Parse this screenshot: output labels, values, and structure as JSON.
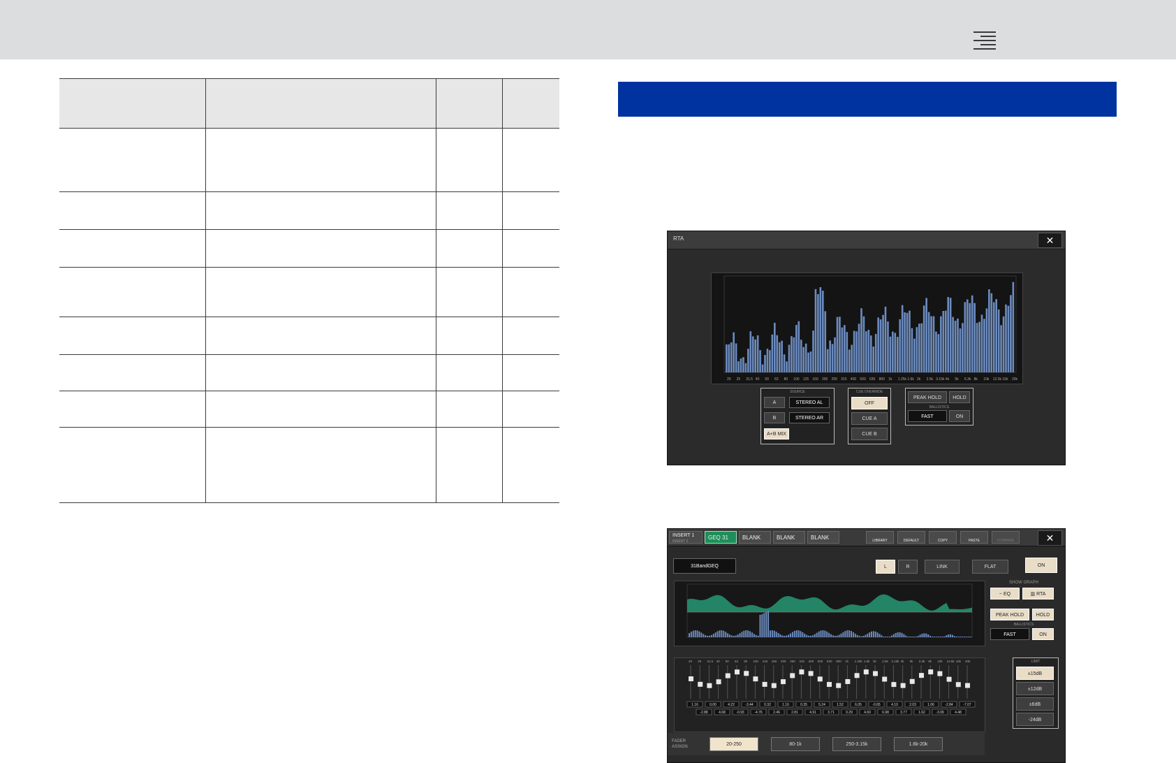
{
  "rta_window": {
    "title": "RTA",
    "close": "✕",
    "source_label": "SOURCE",
    "btn_a": "A",
    "btn_b": "B",
    "btn_ab": "A+B MIX",
    "stereo_al": "STEREO AL",
    "stereo_ar": "STEREO AR",
    "cue_override_label": "CUE OVERRIDE",
    "cue_off": "OFF",
    "cue_a": "CUE A",
    "cue_b": "CUE B",
    "peak_hold": "PEAK HOLD",
    "hold": "HOLD",
    "ballistics_label": "BALLISTICS",
    "ballistics_value": "FAST",
    "ballistics_on": "ON",
    "freq_labels": [
      "20",
      "25",
      "31.5",
      "40",
      "50",
      "63",
      "80",
      "100",
      "125",
      "160",
      "200",
      "250",
      "315",
      "400",
      "500",
      "630",
      "800",
      "1k",
      "1.25k",
      "1.6k",
      "2k",
      "2.5k",
      "3.15k",
      "4k",
      "5k",
      "6.3k",
      "8k",
      "10k",
      "12.5k",
      "16k",
      "20k"
    ]
  },
  "geq_window": {
    "insert_label": "INSERT 1",
    "insert_sub": "INSERT 2",
    "tab_active": "GEQ 31",
    "tabs": [
      "BLANK",
      "BLANK",
      "BLANK"
    ],
    "toolbar": [
      "LIBRARY",
      "DEFAULT",
      "COPY",
      "PASTE",
      "COMPARE"
    ],
    "close": "✕",
    "preset_name": "31BandGEQ",
    "btn_l": "L",
    "btn_r": "R",
    "btn_link": "LINK",
    "btn_flat": "FLAT",
    "btn_on": "ON",
    "show_graph": "SHOW GRAPH",
    "eq": "EQ",
    "rta": "RTA",
    "peak_hold": "PEAK HOLD",
    "hold": "HOLD",
    "ballistics_label": "BALLISTICS",
    "ballistics_value": "FAST",
    "ballistics_on": "ON",
    "limit_label": "LIMIT",
    "limits": [
      "±15dB",
      "±12dB",
      "±6dB",
      "-24dB"
    ],
    "fader_assign_label": "FADER ASSIGN",
    "fader_assign": [
      "20-250",
      "80-1k",
      "250-3.15k",
      "1.6k-20k"
    ],
    "band_values_top": [
      "1.16",
      "0.00",
      "4.22",
      "-3.44",
      "0.32",
      "1.16",
      "0.35",
      "5.24",
      "1.52",
      "6.05",
      "-0.65",
      "4.10",
      "2.03",
      "1.06",
      "-2.84",
      "-7.07"
    ],
    "band_values_bottom": [
      "-2.88",
      "4.68",
      "-0.93",
      "-4.76",
      "2.46",
      "2.81",
      "4.91",
      "3.71",
      "0.29",
      "4.69",
      "6.98",
      "3.77",
      "1.62",
      "-3.09",
      "4.48"
    ],
    "freq_labels": [
      "20",
      "25",
      "31.5",
      "40",
      "50",
      "63",
      "80",
      "100",
      "125",
      "160",
      "200",
      "250",
      "315",
      "400",
      "500",
      "630",
      "800",
      "1k",
      "1.25k",
      "1.6k",
      "2k",
      "2.5k",
      "3.15k",
      "4k",
      "5k",
      "6.3k",
      "8k",
      "10k",
      "12.5k",
      "16k",
      "20k"
    ]
  },
  "colors": {
    "banner": "#0033a0",
    "rta_bar": "#6c8cc0",
    "eq_curve": "#27a07a"
  }
}
